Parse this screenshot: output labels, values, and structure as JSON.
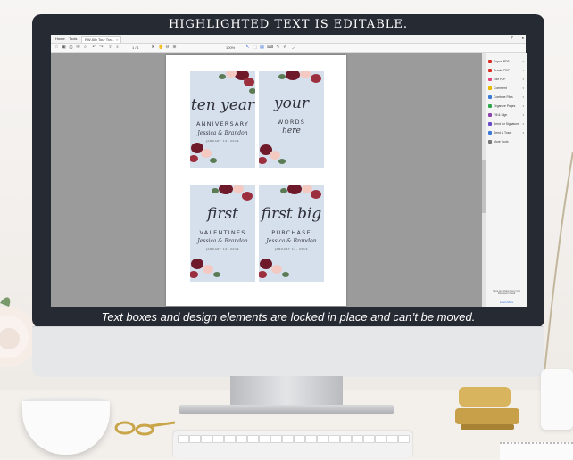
{
  "headline": "HIGHLIGHTED TEXT IS EDITABLE.",
  "caption": "Text boxes and design elements are locked in place and can’t be moved.",
  "app": {
    "tabs": [
      {
        "label": "Home"
      },
      {
        "label": "Tools"
      },
      {
        "label": "RW Ally Tour Tra..."
      }
    ],
    "page_indicator": "1 / 1",
    "zoom": "100%",
    "right_pane": {
      "tools": [
        {
          "label": "Export PDF",
          "icon": "export-pdf-icon",
          "color": "#d93025"
        },
        {
          "label": "Create PDF",
          "icon": "create-pdf-icon",
          "color": "#d93025"
        },
        {
          "label": "Edit PDF",
          "icon": "edit-pdf-icon",
          "color": "#e0457b"
        },
        {
          "label": "Comment",
          "icon": "comment-icon",
          "color": "#e6b800"
        },
        {
          "label": "Combine Files",
          "icon": "combine-files-icon",
          "color": "#3b7bd6"
        },
        {
          "label": "Organize Pages",
          "icon": "organize-pages-icon",
          "color": "#2ea84a"
        },
        {
          "label": "Fill & Sign",
          "icon": "fill-sign-icon",
          "color": "#8e44ad"
        },
        {
          "label": "Send for Signature",
          "icon": "send-signature-icon",
          "color": "#6a4bc9"
        },
        {
          "label": "Send & Track",
          "icon": "send-track-icon",
          "color": "#3b7bd6"
        },
        {
          "label": "More Tools",
          "icon": "more-tools-icon",
          "color": "#777777"
        }
      ],
      "promo_text": "Store and share files in the Document Cloud",
      "learn_more": "Learn More"
    }
  },
  "cards": [
    {
      "line1": "ten year",
      "line2": "ANNIVERSARY",
      "names": "Jessica & Brandon",
      "date": "JANUARY 12, 2019"
    },
    {
      "line1": "your",
      "line2": "WORDS",
      "line3": "here",
      "names": "",
      "date": ""
    },
    {
      "line1": "first",
      "line2": "VALENTINES",
      "names": "Jessica & Brandon",
      "date": "JANUARY 12, 2019"
    },
    {
      "line1": "first big",
      "line2": "PURCHASE",
      "names": "Jessica & Brandon",
      "date": "JANUARY 12, 2019"
    }
  ],
  "colors": {
    "monitor_bezel": "#262a33",
    "card_background": "#d5e0ec",
    "flower_burgundy": "#6e1a2a",
    "flower_blush": "#f3c9c2",
    "leaf_green": "#5b7b55"
  }
}
